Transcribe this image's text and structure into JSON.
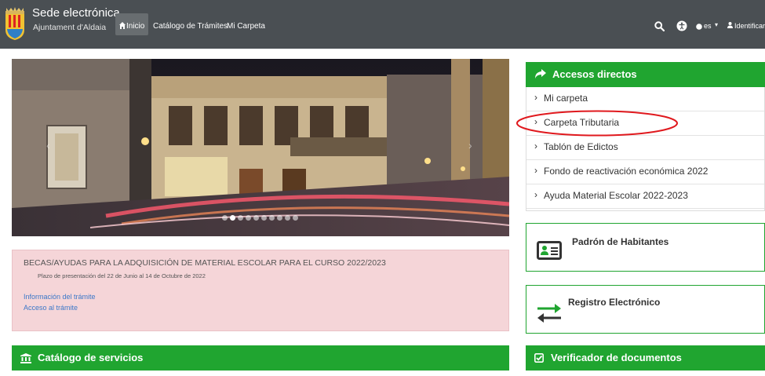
{
  "header": {
    "brand_title": "Sede electrónica",
    "brand_subtitle": "Ajuntament d'Aldaia",
    "nav": [
      {
        "label": "Inicio",
        "active": true
      },
      {
        "label": "Catálogo de Trámites"
      },
      {
        "label": "Mi Carpeta"
      }
    ],
    "language": "es",
    "login_label": "Identificar"
  },
  "carousel": {
    "slide_count": 10,
    "active_slide": 2
  },
  "notice": {
    "title": "BECAS/AYUDAS PARA LA ADQUISICIÓN DE MATERIAL ESCOLAR PARA EL CURSO 2022/2023",
    "subtitle": "Plazo de presentación del 22 de Junio al 14 de Octubre de 2022",
    "links": [
      "Información del trámite",
      "Acceso al trámite"
    ]
  },
  "catalog": {
    "title": "Catálogo de servicios"
  },
  "quick_access": {
    "title": "Accesos directos",
    "items": [
      "Mi carpeta",
      "Carpeta Tributaria",
      "Tablón de Edictos",
      "Fondo de reactivación económica 2022",
      "Ayuda Material Escolar 2022-2023"
    ]
  },
  "services": {
    "padron": "Padrón de Habitantes",
    "registro": "Registro Electrónico"
  },
  "verifier": {
    "title": "Verificador de documentos"
  },
  "colors": {
    "navbar": "#4a4f53",
    "green": "#20a530",
    "notice_bg": "#f5d5d8",
    "link": "#3c78c8",
    "annotation": "#e0191e"
  },
  "icons": [
    "home-icon",
    "search-icon",
    "accessibility-icon",
    "globe-icon",
    "user-icon",
    "share-arrow-icon",
    "chevron-right-icon",
    "id-card-icon",
    "transfer-arrows-icon",
    "institution-icon",
    "check-square-icon"
  ]
}
